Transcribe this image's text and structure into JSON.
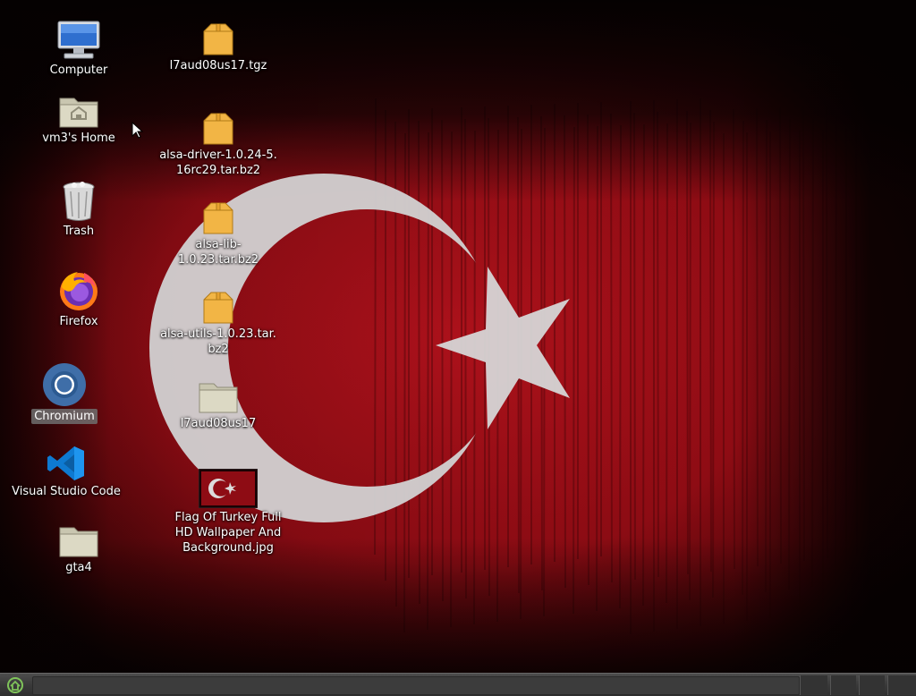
{
  "desktop": {
    "left_column": [
      {
        "name": "Computer",
        "icon": "computer-icon"
      },
      {
        "name": "vm3's Home",
        "icon": "home-folder-icon"
      },
      {
        "name": "Trash",
        "icon": "trash-icon"
      },
      {
        "name": "Firefox",
        "icon": "firefox-icon"
      },
      {
        "name": "Chromium",
        "icon": "chromium-icon"
      },
      {
        "name": "Visual Studio Code",
        "icon": "vscode-icon"
      },
      {
        "name": "gta4",
        "icon": "folder-icon"
      }
    ],
    "right_column": [
      {
        "name": "l7aud08us17.tgz",
        "icon": "archive-icon"
      },
      {
        "name": "alsa-driver-1.0.24-5.16rc29.tar.bz2",
        "line1": "alsa-driver-1.0.24-5.",
        "line2": "16rc29.tar.bz2",
        "icon": "archive-icon"
      },
      {
        "name": "alsa-lib-1.0.23.tar.bz2",
        "icon": "archive-icon"
      },
      {
        "name": "alsa-utils-1.0.23.tar.bz2",
        "line1": "alsa-utils-1.0.23.tar.",
        "line2": "bz2",
        "icon": "archive-icon"
      },
      {
        "name": "l7aud08us17",
        "icon": "folder-icon"
      },
      {
        "name": "Flag Of Turkey Full HD Wallpaper And Background.jpg",
        "line1": "Flag Of Turkey Full",
        "line2": "HD Wallpaper And",
        "line3": "Background.jpg",
        "icon": "image-thumbnail-icon"
      }
    ],
    "selected_item": "Chromium"
  },
  "colors": {
    "flag_red": "#b3101a",
    "crescent_white": "#d9d9d9",
    "folder_beige": "#d8d4bf",
    "archive_orange": "#f2b545",
    "taskbar": "#3a3a3a"
  },
  "taskbar": {
    "menu_icon": "menu-start-icon"
  }
}
